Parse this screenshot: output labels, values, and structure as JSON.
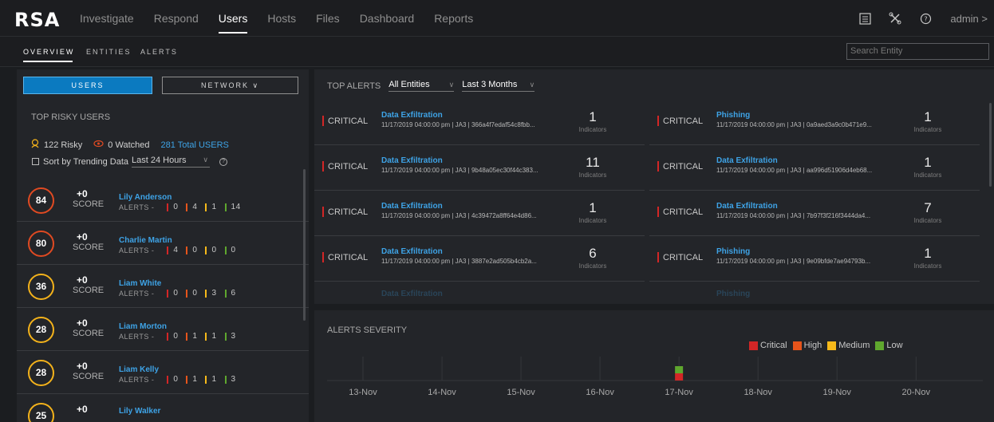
{
  "brand": {
    "logo": "RSA"
  },
  "nav": {
    "items": [
      "Investigate",
      "Respond",
      "Users",
      "Hosts",
      "Files",
      "Dashboard",
      "Reports"
    ],
    "active": "Users",
    "admin_label": "admin",
    "admin_chevron": ">"
  },
  "subnav": {
    "tabs": [
      "OVERVIEW",
      "ENTITIES",
      "ALERTS"
    ],
    "active": "OVERVIEW",
    "search_placeholder": "Search Entity"
  },
  "left_panel": {
    "users_button": "USERS",
    "network_button": "NETWORK ∨",
    "title": "TOP RISKY USERS",
    "risky": "122 Risky",
    "watched": "0 Watched",
    "total": "281 Total USERS",
    "sort_label": "Sort by Trending Data",
    "period": "Last 24 Hours",
    "help": "?",
    "score_label": "SCORE",
    "alerts_label": "ALERTS -",
    "users": [
      {
        "score": "84",
        "delta": "+0",
        "name": "Lily Anderson",
        "critical": "0",
        "high": "4",
        "medium": "1",
        "low": "14",
        "ring": "red"
      },
      {
        "score": "80",
        "delta": "+0",
        "name": "Charlie Martin",
        "critical": "4",
        "high": "0",
        "medium": "0",
        "low": "0",
        "ring": "red"
      },
      {
        "score": "36",
        "delta": "+0",
        "name": "Liam White",
        "critical": "0",
        "high": "0",
        "medium": "3",
        "low": "6",
        "ring": "yellow"
      },
      {
        "score": "28",
        "delta": "+0",
        "name": "Liam Morton",
        "critical": "0",
        "high": "1",
        "medium": "1",
        "low": "3",
        "ring": "yellow"
      },
      {
        "score": "28",
        "delta": "+0",
        "name": "Liam Kelly",
        "critical": "0",
        "high": "1",
        "medium": "1",
        "low": "3",
        "ring": "yellow"
      },
      {
        "score": "25",
        "delta": "+0",
        "name": "Lily Walker",
        "critical": "",
        "high": "",
        "medium": "",
        "low": "",
        "ring": "yellow"
      }
    ]
  },
  "top_alerts": {
    "title": "TOP ALERTS",
    "entity_filter": "All Entities",
    "period_filter": "Last 3 Months",
    "indicators_label": "Indicators",
    "left": [
      {
        "severity": "CRITICAL",
        "title": "Data Exfiltration",
        "meta": "11/17/2019 04:00:00 pm  |  JA3  |  366a4f7edaf54c8fbb...",
        "count": "1"
      },
      {
        "severity": "CRITICAL",
        "title": "Data Exfiltration",
        "meta": "11/17/2019 04:00:00 pm  |  JA3  |  9b48a05ec30f44c383...",
        "count": "11"
      },
      {
        "severity": "CRITICAL",
        "title": "Data Exfiltration",
        "meta": "11/17/2019 04:00:00 pm  |  JA3  |  4c39472a8ff64e4d86...",
        "count": "1"
      },
      {
        "severity": "CRITICAL",
        "title": "Data Exfiltration",
        "meta": "11/17/2019 04:00:00 pm  |  JA3  |  3887e2ad505b4cb2a...",
        "count": "6"
      }
    ],
    "right": [
      {
        "severity": "CRITICAL",
        "title": "Phishing",
        "meta": "11/17/2019 04:00:00 pm  |  JA3  |  0a9aed3a9c0b471e9...",
        "count": "1"
      },
      {
        "severity": "CRITICAL",
        "title": "Data Exfiltration",
        "meta": "11/17/2019 04:00:00 pm  |  JA3  |  aa996d51906d4eb68...",
        "count": "1"
      },
      {
        "severity": "CRITICAL",
        "title": "Data Exfiltration",
        "meta": "11/17/2019 04:00:00 pm  |  JA3  |  7b97f3f216f3444da4...",
        "count": "7"
      },
      {
        "severity": "CRITICAL",
        "title": "Phishing",
        "meta": "11/17/2019 04:00:00 pm  |  JA3  |  9e09bfde7ae94793b...",
        "count": "1"
      }
    ],
    "partial_left_title": "Data Exfiltration",
    "partial_right_title": "Phishing"
  },
  "severity_chart": {
    "title": "ALERTS SEVERITY",
    "legend": [
      "Critical",
      "High",
      "Medium",
      "Low"
    ],
    "colors": {
      "critical": "#d32626",
      "high": "#e6541b",
      "medium": "#f6b91a",
      "low": "#5fa72e",
      "accent": "#0b7ac0",
      "link": "#3ea3e6"
    },
    "chart_data": {
      "type": "bar",
      "categories": [
        "13-Nov",
        "14-Nov",
        "15-Nov",
        "16-Nov",
        "17-Nov",
        "18-Nov",
        "19-Nov",
        "20-Nov"
      ],
      "series": [
        {
          "name": "Critical",
          "values": [
            0,
            0,
            0,
            0,
            1,
            0,
            0,
            0
          ]
        },
        {
          "name": "High",
          "values": [
            0,
            0,
            0,
            0,
            0,
            0,
            0,
            0
          ]
        },
        {
          "name": "Medium",
          "values": [
            0,
            0,
            0,
            0,
            0,
            0,
            0,
            0
          ]
        },
        {
          "name": "Low",
          "values": [
            0,
            0,
            0,
            0,
            1,
            0,
            0,
            0
          ]
        }
      ]
    }
  }
}
